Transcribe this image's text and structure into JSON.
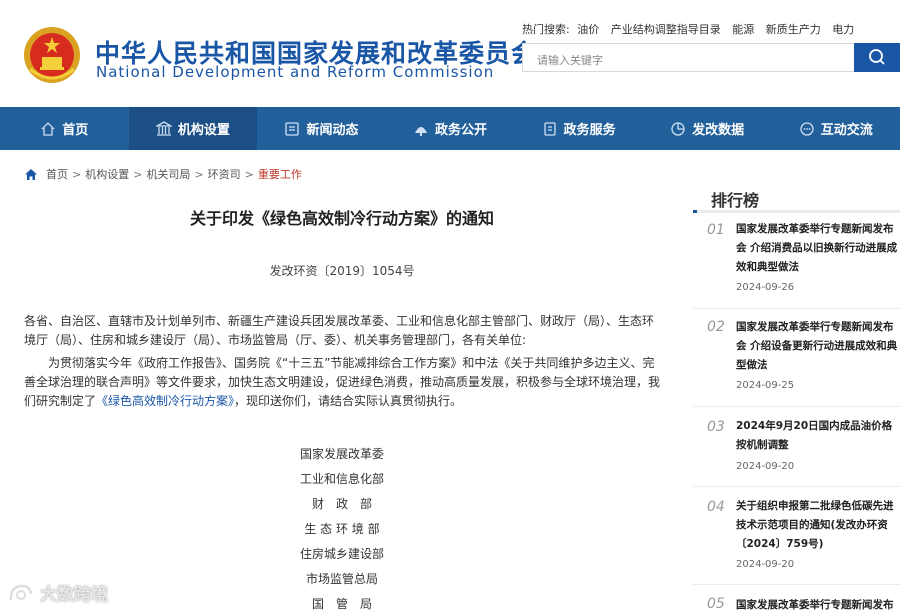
{
  "header": {
    "logo_cn": "中华人民共和国国家发展和改革委员会",
    "logo_en": "National Development and Reform Commission",
    "hot_label": "热门搜索:",
    "hot_keywords": [
      "油价",
      "产业结构调整指导目录",
      "能源",
      "新质生产力",
      "电力"
    ],
    "search_placeholder": "请输入关键字"
  },
  "nav": [
    {
      "label": "首页",
      "icon": "home-icon"
    },
    {
      "label": "机构设置",
      "icon": "institution-icon"
    },
    {
      "label": "新闻动态",
      "icon": "news-icon"
    },
    {
      "label": "政务公开",
      "icon": "public-affairs-icon"
    },
    {
      "label": "政务服务",
      "icon": "service-icon"
    },
    {
      "label": "发改数据",
      "icon": "data-icon"
    },
    {
      "label": "互动交流",
      "icon": "chat-icon"
    }
  ],
  "breadcrumb": [
    "首页",
    "机构设置",
    "机关司局",
    "环资司",
    "重要工作"
  ],
  "article": {
    "title": "关于印发《绿色高效制冷行动方案》的通知",
    "doc_number": "发改环资〔2019〕1054号",
    "recipients": "各省、自治区、直辖市及计划单列市、新疆生产建设兵团发展改革委、工业和信息化部主管部门、财政厅（局）、生态环境厅（局）、住房和城乡建设厅（局）、市场监管局（厅、委）、机关事务管理部门，各有关单位:",
    "body_prefix": "为贯彻落实今年《政府工作报告》、国务院《“十三五”节能减排综合工作方案》和中法《关于共同维护多边主义、完善全球治理的联合声明》等文件要求，加快生态文明建设，促进绿色消费，推动高质量发展，积极参与全球环境治理，我们研究制定了",
    "body_link": "《绿色高效制冷行动方案》",
    "body_suffix": "，现印送你们，请结合实际认真贯彻执行。",
    "signers": [
      "国家发展改革委",
      "工业和信息化部",
      "财　政　部",
      "生 态 环 境 部",
      "住房城乡建设部",
      "市场监管总局",
      "国　管　局"
    ]
  },
  "watermark": "大数跨境",
  "sidebar": {
    "title": "排行榜",
    "items": [
      {
        "num": "01",
        "title": "国家发展改革委举行专题新闻发布会 介绍消费品以旧换新行动进展成效和典型做法",
        "date": "2024-09-26"
      },
      {
        "num": "02",
        "title": "国家发展改革委举行专题新闻发布会 介绍设备更新行动进展成效和典型做法",
        "date": "2024-09-25"
      },
      {
        "num": "03",
        "title": "2024年9月20日国内成品油价格按机制调整",
        "date": "2024-09-20"
      },
      {
        "num": "04",
        "title": "关于组织申报第二批绿色低碳先进技术示范项目的通知(发改办环资〔2024〕759号)",
        "date": "2024-09-20"
      },
      {
        "num": "05",
        "title": "国家发展改革委举行专题新闻发布",
        "date": ""
      }
    ]
  },
  "colors": {
    "brand_blue": "#1a56a6",
    "nav_bg": "#22609b",
    "nav_active": "#1b4f86",
    "breadcrumb_current": "#c0392b"
  }
}
